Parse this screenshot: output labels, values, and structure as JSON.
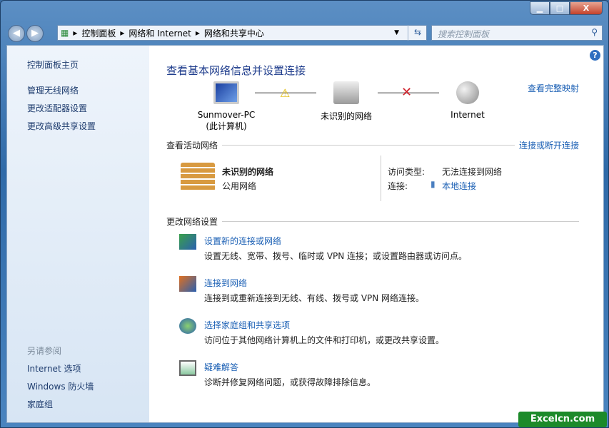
{
  "window": {
    "min": "▁",
    "max": "□",
    "close": "X"
  },
  "address": {
    "crumbs": [
      "控制面板",
      "网络和 Internet",
      "网络和共享中心"
    ],
    "search_placeholder": "搜索控制面板"
  },
  "sidebar": {
    "items": [
      "控制面板主页",
      "管理无线网络",
      "更改适配器设置",
      "更改高级共享设置"
    ],
    "see_also": "另请参阅",
    "see_also_items": [
      "Internet 选项",
      "Windows 防火墙",
      "家庭组"
    ]
  },
  "main": {
    "title": "查看基本网络信息并设置连接",
    "full_map": "查看完整映射",
    "map": {
      "computer": "Sunmover-PC",
      "computer_sub": "(此计算机)",
      "network": "未识别的网络",
      "internet": "Internet"
    },
    "active_header": "查看活动网络",
    "connect_link": "连接或断开连接",
    "active": {
      "name": "未识别的网络",
      "type": "公用网络",
      "access_label": "访问类型:",
      "access_value": "无法连接到网络",
      "conn_label": "连接:",
      "conn_value": "本地连接"
    },
    "change_header": "更改网络设置",
    "tasks": [
      {
        "title": "设置新的连接或网络",
        "desc": "设置无线、宽带、拨号、临时或 VPN 连接；或设置路由器或访问点。"
      },
      {
        "title": "连接到网络",
        "desc": "连接到或重新连接到无线、有线、拨号或 VPN 网络连接。"
      },
      {
        "title": "选择家庭组和共享选项",
        "desc": "访问位于其他网络计算机上的文件和打印机，或更改共享设置。"
      },
      {
        "title": "疑难解答",
        "desc": "诊断并修复网络问题，或获得故障排除信息。"
      }
    ]
  },
  "watermark": "Excelcn.com"
}
